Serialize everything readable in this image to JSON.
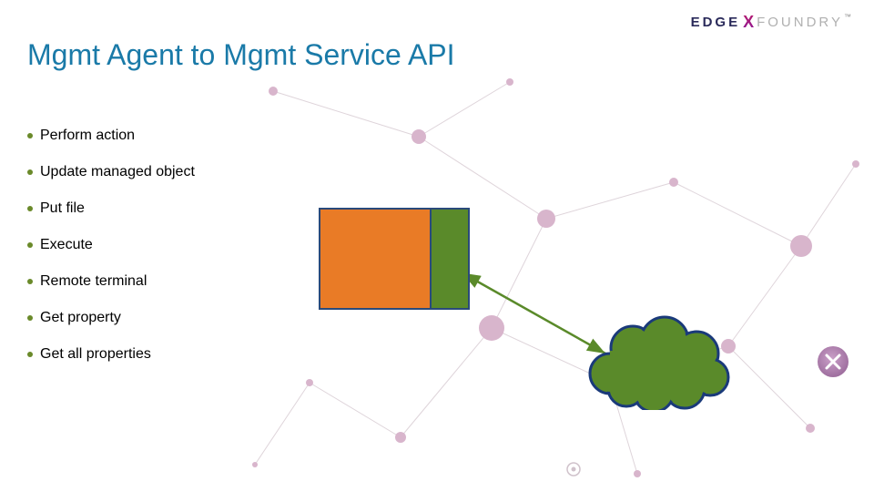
{
  "brand": {
    "left": "EDGE",
    "mid": "X",
    "right": "FOUNDRY",
    "tm": "™"
  },
  "title": "Mgmt Agent to Mgmt Service API",
  "bullets": [
    "Perform action",
    "Update managed object",
    "Put file",
    "Execute",
    "Remote terminal",
    "Get property",
    "Get all properties"
  ],
  "diagram": {
    "box_orange_color": "#e97b26",
    "box_green_color": "#5a8a2a",
    "cloud_color": "#5a8a2a",
    "arrow_color": "#5a8a2a"
  }
}
